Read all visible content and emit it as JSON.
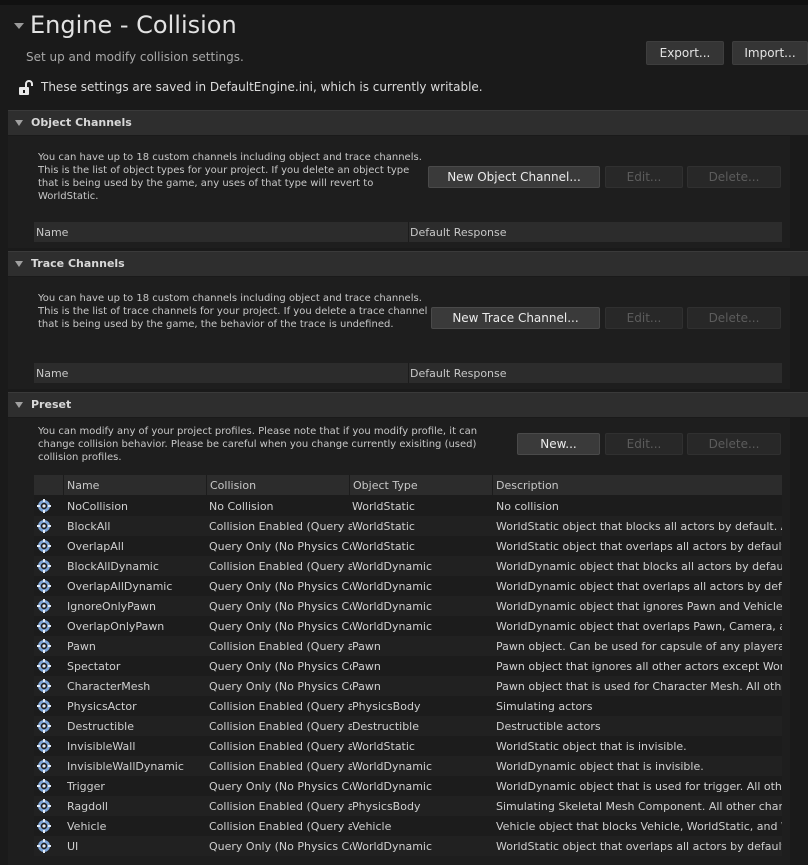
{
  "header": {
    "title": "Engine - Collision",
    "subtitle": "Set up and modify collision settings.",
    "export_label": "Export...",
    "import_label": "Import...",
    "save_note": "These settings are saved in DefaultEngine.ini, which is currently writable."
  },
  "object_channels": {
    "title": "Object Channels",
    "description": "You can have up to 18 custom channels including object and trace channels. This is the list of object types for your project. If you delete an object type that is being used by the game, any uses of that type will revert to WorldStatic.",
    "new_label": "New Object Channel...",
    "edit_label": "Edit...",
    "delete_label": "Delete...",
    "columns": [
      "Name",
      "Default Response"
    ]
  },
  "trace_channels": {
    "title": "Trace Channels",
    "description": "You can have up to 18 custom channels including object and trace channels. This is the list of trace channels for your project. If you delete a trace channel that is being used by the game, the behavior of the trace is undefined.",
    "new_label": "New Trace Channel...",
    "edit_label": "Edit...",
    "delete_label": "Delete...",
    "columns": [
      "Name",
      "Default Response"
    ]
  },
  "preset": {
    "title": "Preset",
    "description": "You can modify any of your project profiles. Please note that if you modify profile, it can change collision behavior. Please be careful when you change currently exisiting (used) collision profiles.",
    "new_label": "New...",
    "edit_label": "Edit...",
    "delete_label": "Delete...",
    "columns": [
      "Name",
      "Collision",
      "Object Type",
      "Description"
    ],
    "rows": [
      [
        "NoCollision",
        "No Collision",
        "WorldStatic",
        "No collision"
      ],
      [
        "BlockAll",
        "Collision Enabled (Query and",
        "WorldStatic",
        "WorldStatic object that blocks all actors by default. All ne"
      ],
      [
        "OverlapAll",
        "Query Only (No Physics Coll",
        "WorldStatic",
        "WorldStatic object that overlaps all actors by default. All"
      ],
      [
        "BlockAllDynamic",
        "Collision Enabled (Query and",
        "WorldDynamic",
        "WorldDynamic object that blocks all actors by default. All"
      ],
      [
        "OverlapAllDynamic",
        "Query Only (No Physics Coll",
        "WorldDynamic",
        "WorldDynamic object that overlaps all actors by default. A"
      ],
      [
        "IgnoreOnlyPawn",
        "Query Only (No Physics Coll",
        "WorldDynamic",
        "WorldDynamic object that ignores Pawn and Vehicle. All o"
      ],
      [
        "OverlapOnlyPawn",
        "Query Only (No Physics Coll",
        "WorldDynamic",
        "WorldDynamic object that overlaps Pawn, Camera, and Ve"
      ],
      [
        "Pawn",
        "Collision Enabled (Query and",
        "Pawn",
        "Pawn object. Can be used for capsule of any playerable ch"
      ],
      [
        "Spectator",
        "Query Only (No Physics Coll",
        "Pawn",
        "Pawn object that ignores all other actors except WorldSta"
      ],
      [
        "CharacterMesh",
        "Query Only (No Physics Coll",
        "Pawn",
        "Pawn object that is used for Character Mesh. All other ch"
      ],
      [
        "PhysicsActor",
        "Collision Enabled (Query and",
        "PhysicsBody",
        "Simulating actors"
      ],
      [
        "Destructible",
        "Collision Enabled (Query and",
        "Destructible",
        "Destructible actors"
      ],
      [
        "InvisibleWall",
        "Collision Enabled (Query and",
        "WorldStatic",
        "WorldStatic object that is invisible."
      ],
      [
        "InvisibleWallDynamic",
        "Collision Enabled (Query and",
        "WorldDynamic",
        "WorldDynamic object that is invisible."
      ],
      [
        "Trigger",
        "Query Only (No Physics Coll",
        "WorldDynamic",
        "WorldDynamic object that is used for trigger. All other cha"
      ],
      [
        "Ragdoll",
        "Collision Enabled (Query and",
        "PhysicsBody",
        "Simulating Skeletal Mesh Component. All other channels"
      ],
      [
        "Vehicle",
        "Collision Enabled (Query and",
        "Vehicle",
        "Vehicle object that blocks Vehicle, WorldStatic, and World"
      ],
      [
        "UI",
        "Query Only (No Physics Coll",
        "WorldDynamic",
        "WorldStatic object that overlaps all actors by default. All"
      ]
    ]
  },
  "icons": {
    "row_icon": "gear-badge-icon",
    "lock": "unlocked-padlock-icon"
  },
  "colors": {
    "background": "#1a1a1a",
    "section_header": "#2e2e2e",
    "icon_blue": "#7fa6d8"
  }
}
